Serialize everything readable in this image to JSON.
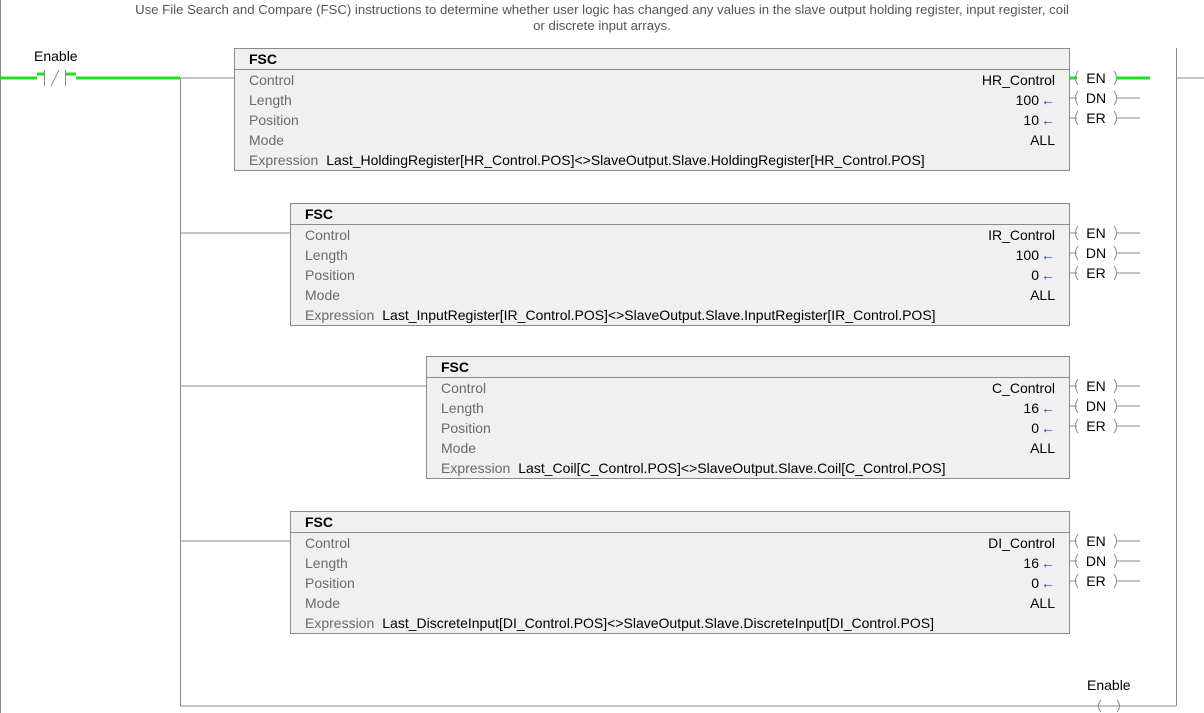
{
  "rung_comment": {
    "line1": "Use File Search and Compare (FSC) instructions to determine whether user logic has changed any values in the slave output holding register, input register, coil",
    "line2": "or discrete input arrays."
  },
  "contact": {
    "tag": "Enable",
    "symbol": "/"
  },
  "field_labels": {
    "control": "Control",
    "length": "Length",
    "position": "Position",
    "mode": "Mode",
    "expression": "Expression"
  },
  "output_bits": {
    "en": "EN",
    "dn": "DN",
    "er": "ER"
  },
  "value_arrow": "←",
  "fsc_blocks": [
    {
      "name": "FSC",
      "control": "HR_Control",
      "length": "100",
      "position": "10",
      "mode": "ALL",
      "expression": "Last_HoldingRegister[HR_Control.POS]<>SlaveOutput.Slave.HoldingRegister[HR_Control.POS]",
      "en_energized": true
    },
    {
      "name": "FSC",
      "control": "IR_Control",
      "length": "100",
      "position": "0",
      "mode": "ALL",
      "expression": "Last_InputRegister[IR_Control.POS]<>SlaveOutput.Slave.InputRegister[IR_Control.POS]",
      "en_energized": false
    },
    {
      "name": "FSC",
      "control": "C_Control",
      "length": "16",
      "position": "0",
      "mode": "ALL",
      "expression": "Last_Coil[C_Control.POS]<>SlaveOutput.Slave.Coil[C_Control.POS]",
      "en_energized": false
    },
    {
      "name": "FSC",
      "control": "DI_Control",
      "length": "16",
      "position": "0",
      "mode": "ALL",
      "expression": "Last_DiscreteInput[DI_Control.POS]<>SlaveOutput.Slave.DiscreteInput[DI_Control.POS]",
      "en_energized": false
    }
  ],
  "output_coil": {
    "tag": "Enable",
    "energized": false
  },
  "colors": {
    "energized": "#22dd22",
    "wire": "#8a8a8a",
    "arrow": "#1f3fd6",
    "box_fill": "#f0f0f0"
  }
}
